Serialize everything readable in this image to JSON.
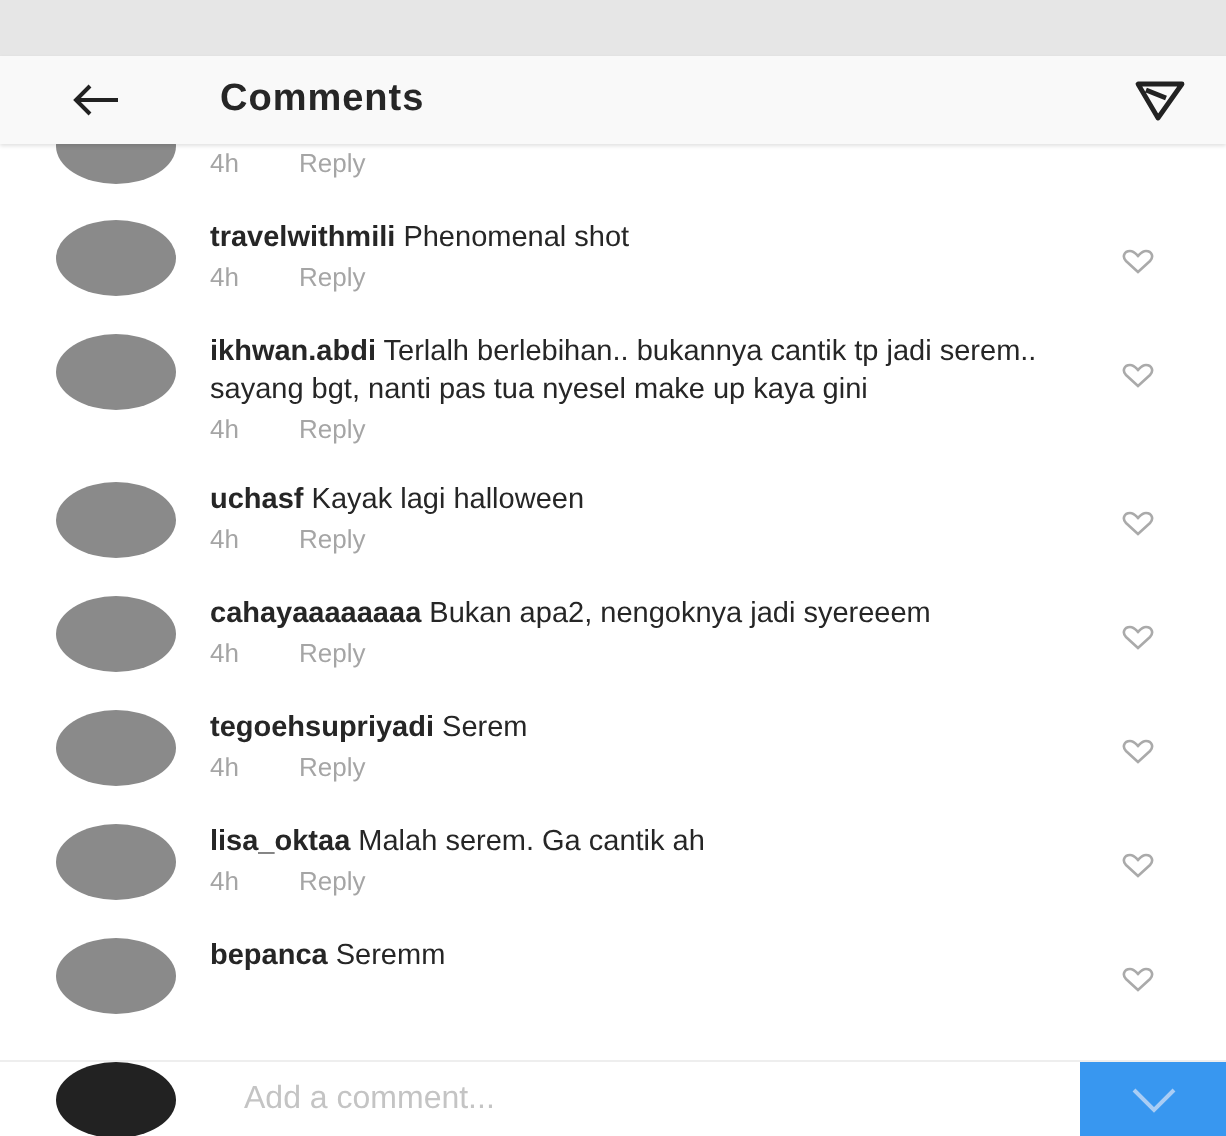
{
  "header": {
    "title": "Comments"
  },
  "comments": [
    {
      "kind": "partial",
      "time": "4h",
      "reply": "Reply"
    },
    {
      "kind": "full",
      "user": "travelwithmili",
      "text": "Phenomenal shot",
      "time": "4h",
      "reply": "Reply"
    },
    {
      "kind": "full",
      "user": "ikhwan.abdi",
      "text": "Terlalh berlebihan.. bukannya cantik tp jadi serem.. sayang bgt, nanti pas tua nyesel make up kaya gini",
      "time": "4h",
      "reply": "Reply"
    },
    {
      "kind": "full",
      "user": "uchasf",
      "text": "Kayak lagi halloween",
      "time": "4h",
      "reply": "Reply"
    },
    {
      "kind": "full",
      "user": "cahayaaaaaaaa",
      "text": "Bukan apa2, nengoknya jadi syereeem",
      "time": "4h",
      "reply": "Reply"
    },
    {
      "kind": "full",
      "user": "tegoehsupriyadi",
      "text": "Serem",
      "time": "4h",
      "reply": "Reply"
    },
    {
      "kind": "full",
      "user": "lisa_oktaa",
      "text": "Malah serem. Ga cantik ah",
      "time": "4h",
      "reply": "Reply"
    },
    {
      "kind": "full",
      "user": "bepanca",
      "text": "Seremm"
    }
  ],
  "composer": {
    "placeholder": "Add a comment..."
  }
}
